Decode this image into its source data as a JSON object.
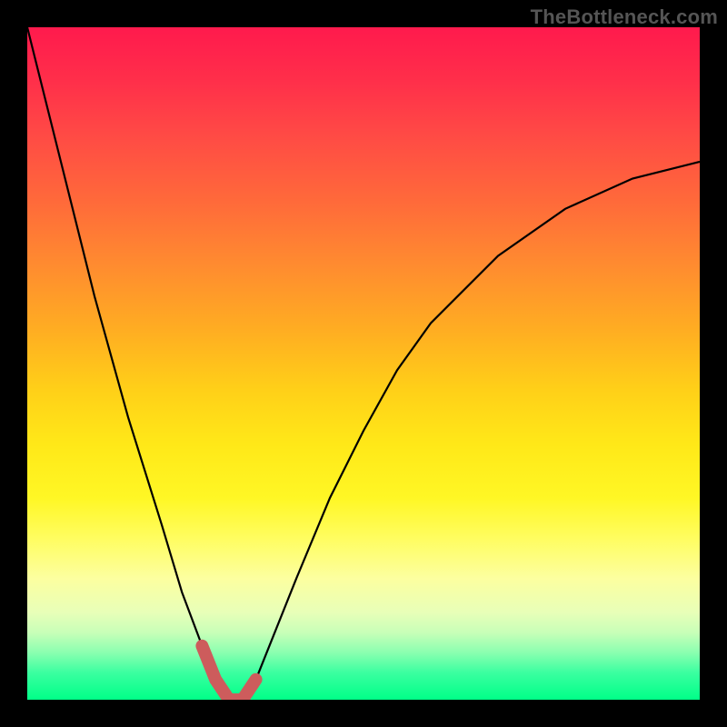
{
  "watermark": "TheBottleneck.com",
  "colors": {
    "bg_outer": "#000000",
    "curve": "#000000",
    "overlay": "#cd5c5c"
  },
  "chart_data": {
    "type": "line",
    "title": "",
    "xlabel": "",
    "ylabel": "",
    "xlim": [
      0,
      100
    ],
    "ylim": [
      0,
      100
    ],
    "grid": false,
    "minimum_x": 30,
    "series": [
      {
        "name": "bottleneck-curve",
        "x": [
          0,
          5,
          10,
          15,
          20,
          23,
          26,
          28,
          30,
          32,
          34,
          36,
          40,
          45,
          50,
          55,
          60,
          70,
          80,
          90,
          100
        ],
        "y": [
          100,
          80,
          60,
          42,
          26,
          16,
          8,
          3,
          0,
          0,
          3,
          8,
          18,
          30,
          40,
          49,
          56,
          66,
          73,
          77.5,
          80
        ]
      }
    ],
    "annotations": [
      {
        "name": "flat-region-overlay",
        "type": "polyline",
        "points_x": [
          26,
          28,
          30,
          32,
          34
        ],
        "points_y": [
          8,
          3,
          0,
          0,
          3
        ]
      }
    ]
  }
}
